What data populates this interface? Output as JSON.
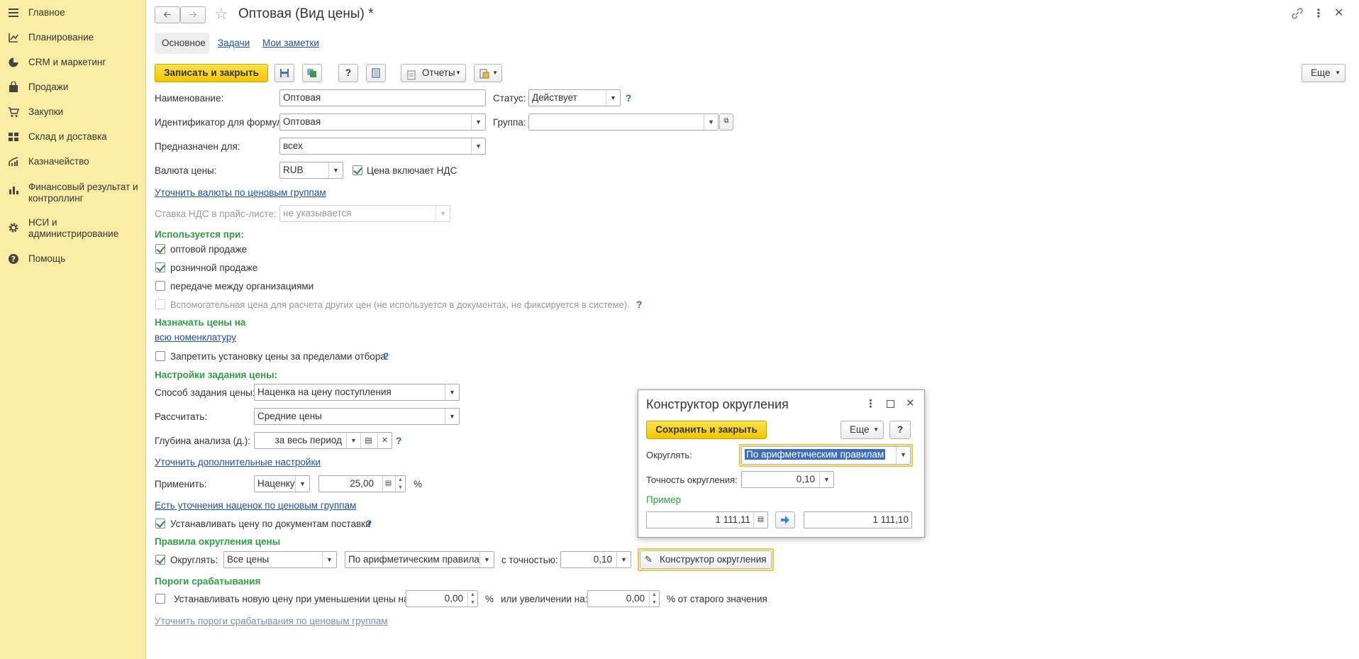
{
  "sidebar": {
    "items": [
      {
        "icon": "menu-icon",
        "label": "Главное"
      },
      {
        "icon": "planning-icon",
        "label": "Планирование"
      },
      {
        "icon": "pie-chart-icon",
        "label": "CRM и маркетинг"
      },
      {
        "icon": "bag-icon",
        "label": "Продажи"
      },
      {
        "icon": "cart-icon",
        "label": "Закупки"
      },
      {
        "icon": "warehouse-icon",
        "label": "Склад и доставка"
      },
      {
        "icon": "treasury-icon",
        "label": "Казначейство"
      },
      {
        "icon": "bar-chart-icon",
        "label": "Финансовый результат и контроллинг"
      },
      {
        "icon": "gear-icon",
        "label": "НСИ и администрирование"
      },
      {
        "icon": "help-icon",
        "label": "Помощь"
      }
    ]
  },
  "header": {
    "title": "Оптовая (Вид цены) *"
  },
  "tabs": {
    "main": "Основное",
    "tasks": "Задачи",
    "notes": "Мои заметки"
  },
  "toolbar": {
    "save_close": "Записать и закрыть",
    "help": "?",
    "reports": "Отчеты",
    "more": "Еще"
  },
  "form": {
    "name_label": "Наименование:",
    "name_value": "Оптовая",
    "status_label": "Статус:",
    "status_value": "Действует",
    "formula_id_label": "Идентификатор для формул:",
    "formula_id_value": "Оптовая",
    "group_label": "Группа:",
    "group_value": "",
    "intended_label": "Предназначен для:",
    "intended_value": "всех",
    "currency_label": "Валюта цены:",
    "currency_value": "RUB",
    "vat_included_label": "Цена включает НДС",
    "currency_groups_link": "Уточнить валюты по ценовым группам",
    "vat_rate_label": "Ставка НДС в прайс-листе:",
    "vat_rate_value": "не указывается",
    "used_when_heading": "Используется при:",
    "wholesale_label": "оптовой продаже",
    "retail_label": "розничной продаже",
    "intercompany_label": "передаче между организациями",
    "auxiliary_label": "Вспомогательная цена для расчета других цен (не используется в документах, не фиксируется в системе).",
    "assign_heading": "Назначать цены на",
    "all_items_link": "всю номенклатуру",
    "forbid_label": "Запретить установку цены за пределами отбора.",
    "settings_heading": "Настройки задания цены:",
    "method_label": "Способ задания цены:",
    "method_value": "Наценка на цену поступления",
    "calc_label": "Рассчитать:",
    "calc_value": "Средние цены",
    "depth_label": "Глубина анализа (д.):",
    "depth_value": "за весь период",
    "extra_settings_link": "Уточнить дополнительные настройки",
    "apply_label": "Применить:",
    "apply_value": "Наценку",
    "apply_amount": "25,00",
    "percent_sign": "%",
    "markup_groups_link": "Есть уточнения наценок по ценовым группам",
    "set_by_docs_label": "Устанавливать цену по документам поставки",
    "rounding_heading": "Правила округления цены",
    "round_label": "Округлять:",
    "round_scope": "Все цены",
    "round_rule": "По арифметическим правилам",
    "precision_label": "с точностью:",
    "precision_value": "0,10",
    "round_constructor_button": "Конструктор округления",
    "thresholds_heading": "Пороги срабатывания",
    "threshold_label": "Устанавливать новую цену при уменьшении цены на:",
    "decrease_value": "0,00",
    "increase_label": "или увеличении на:",
    "increase_value": "0,00",
    "old_value_label": "% от старого значения",
    "threshold_groups_link": "Уточнить пороги срабатывания по ценовым группам"
  },
  "dialog": {
    "title": "Конструктор округления",
    "save_close": "Сохранить и закрыть",
    "more": "Еще",
    "help": "?",
    "round_label": "Округлять:",
    "round_value": "По арифметическим правилам",
    "precision_label": "Точность округления:",
    "precision_value": "0,10",
    "example_heading": "Пример",
    "example_input": "1 111,11",
    "example_result": "1 111,10"
  }
}
